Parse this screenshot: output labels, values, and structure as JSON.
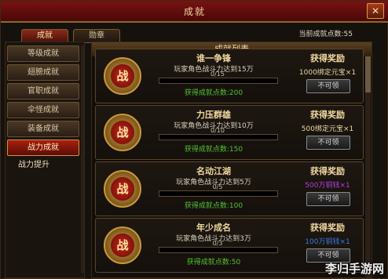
{
  "window": {
    "title": "成就"
  },
  "tabs": [
    {
      "label": "成就"
    },
    {
      "label": "勋章"
    }
  ],
  "points_label": "当前成就点数:55",
  "sidebar": {
    "items": [
      "等级成就",
      "翅膀成就",
      "官职成就",
      "伞怪成就",
      "装备成就",
      "战力成就"
    ],
    "active_index": 5,
    "sub_item": "战力提升"
  },
  "panel": {
    "title": "成就列表"
  },
  "achievements": [
    {
      "title": "谁一争锋",
      "desc": "玩家角色战斗力达到15万",
      "progress": "0/15",
      "progress_value": 0,
      "points": "获得成就点数:200",
      "reward_head": "获得奖励",
      "reward": "1000绑定元宝×1",
      "reward_color": "#e8d8a8",
      "button": "不可领"
    },
    {
      "title": "力压群雄",
      "desc": "玩家角色战斗力达到10万",
      "progress": "0/10",
      "progress_value": 0,
      "points": "获得成就点数:150",
      "reward_head": "获得奖励",
      "reward": "500绑定元宝×1",
      "reward_color": "#e8d8a8",
      "button": "不可领"
    },
    {
      "title": "名动江湖",
      "desc": "玩家角色战斗力达到5万",
      "progress": "0/5",
      "progress_value": 0,
      "points": "获得成就点数:100",
      "reward_head": "获得奖励",
      "reward": "500万铜钱×1",
      "reward_color": "#b040e0",
      "button": "不可领"
    },
    {
      "title": "年少成名",
      "desc": "玩家角色战斗力达到3万",
      "progress": "0/3",
      "progress_value": 0,
      "points": "获得成就点数:50",
      "reward_head": "获得奖励",
      "reward": "100万铜钱×1",
      "reward_color": "#3a7ae0",
      "button": "不可领"
    }
  ],
  "badge_char": "战",
  "icons": {
    "close": "close-icon",
    "badge": "achievement-badge-icon"
  },
  "watermark": "李归手游网"
}
